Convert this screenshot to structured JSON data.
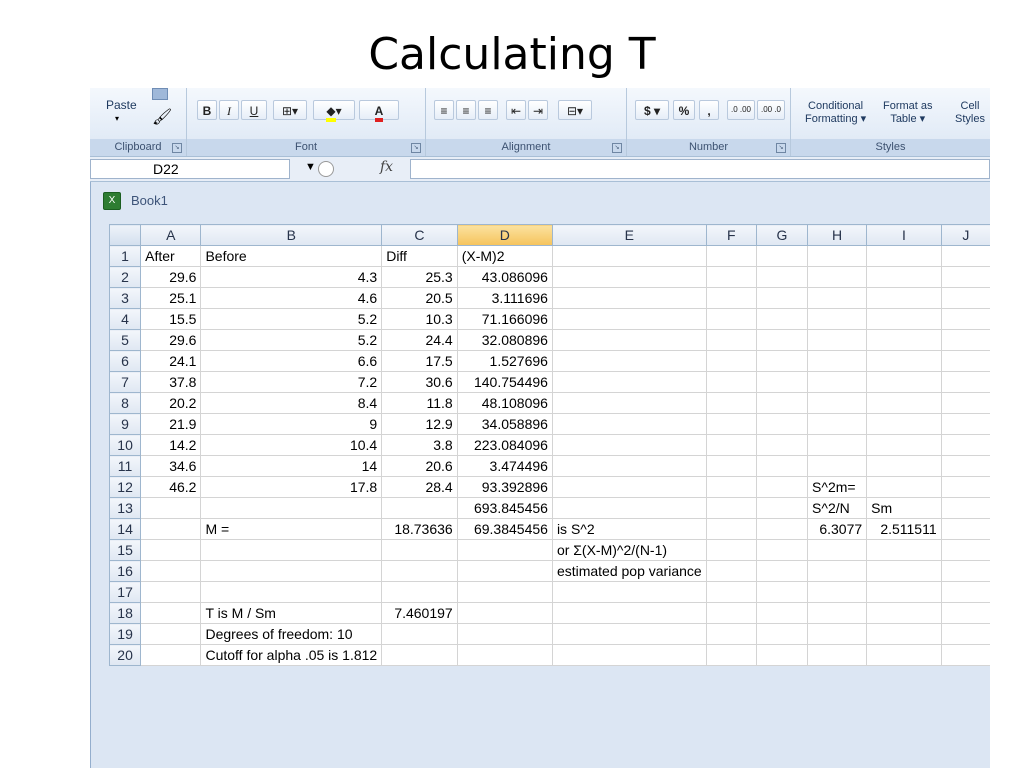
{
  "slide": {
    "title": "Calculating T"
  },
  "ribbon": {
    "paste_label": "Paste",
    "groups": {
      "clipboard": "Clipboard",
      "font": "Font",
      "alignment": "Alignment",
      "number": "Number",
      "styles": "Styles"
    },
    "font_buttons": {
      "bold": "B",
      "italic": "I",
      "underline": "U",
      "font_color": "A"
    },
    "number_buttons": {
      "currency": "$",
      "percent": "%",
      "comma": ",",
      "inc_decimal": ".0 .00",
      "dec_decimal": ".00 .0"
    },
    "styles_buttons": {
      "conditional_line1": "Conditional",
      "conditional_line2": "Formatting",
      "format_table_line1": "Format as",
      "format_table_line2": "Table",
      "cell_styles_line1": "Cell",
      "cell_styles_line2": "Styles"
    }
  },
  "formula_bar": {
    "cell_ref": "D22",
    "fx_label": "fx",
    "value": ""
  },
  "workbook": {
    "title": "Book1"
  },
  "sheet": {
    "columns": [
      "A",
      "B",
      "C",
      "D",
      "E",
      "F",
      "G",
      "H",
      "I",
      "J"
    ],
    "active_column": "D",
    "rows": [
      {
        "n": "1",
        "cells": [
          "After",
          "Before",
          "Diff",
          "(X-M)2",
          "",
          "",
          "",
          "",
          "",
          ""
        ]
      },
      {
        "n": "2",
        "cells": [
          "29.6",
          "4.3",
          "25.3",
          "43.086096",
          "",
          "",
          "",
          "",
          "",
          ""
        ]
      },
      {
        "n": "3",
        "cells": [
          "25.1",
          "4.6",
          "20.5",
          "3.111696",
          "",
          "",
          "",
          "",
          "",
          ""
        ]
      },
      {
        "n": "4",
        "cells": [
          "15.5",
          "5.2",
          "10.3",
          "71.166096",
          "",
          "",
          "",
          "",
          "",
          ""
        ]
      },
      {
        "n": "5",
        "cells": [
          "29.6",
          "5.2",
          "24.4",
          "32.080896",
          "",
          "",
          "",
          "",
          "",
          ""
        ]
      },
      {
        "n": "6",
        "cells": [
          "24.1",
          "6.6",
          "17.5",
          "1.527696",
          "",
          "",
          "",
          "",
          "",
          ""
        ]
      },
      {
        "n": "7",
        "cells": [
          "37.8",
          "7.2",
          "30.6",
          "140.754496",
          "",
          "",
          "",
          "",
          "",
          ""
        ]
      },
      {
        "n": "8",
        "cells": [
          "20.2",
          "8.4",
          "11.8",
          "48.108096",
          "",
          "",
          "",
          "",
          "",
          ""
        ]
      },
      {
        "n": "9",
        "cells": [
          "21.9",
          "9",
          "12.9",
          "34.058896",
          "",
          "",
          "",
          "",
          "",
          ""
        ]
      },
      {
        "n": "10",
        "cells": [
          "14.2",
          "10.4",
          "3.8",
          "223.084096",
          "",
          "",
          "",
          "",
          "",
          ""
        ]
      },
      {
        "n": "11",
        "cells": [
          "34.6",
          "14",
          "20.6",
          "3.474496",
          "",
          "",
          "",
          "",
          "",
          ""
        ]
      },
      {
        "n": "12",
        "cells": [
          "46.2",
          "17.8",
          "28.4",
          "93.392896",
          "",
          "",
          "",
          "S^2m=",
          "",
          ""
        ]
      },
      {
        "n": "13",
        "cells": [
          "",
          "",
          "",
          "693.845456",
          "",
          "",
          "",
          "S^2/N",
          "Sm",
          ""
        ]
      },
      {
        "n": "14",
        "cells": [
          "",
          "M =",
          "18.73636",
          "69.3845456",
          "is S^2",
          "",
          "",
          "6.3077",
          "2.511511",
          ""
        ]
      },
      {
        "n": "15",
        "cells": [
          "",
          "",
          "",
          "",
          "or Σ(X-M)^2/(N-1)",
          "",
          "",
          "",
          "",
          ""
        ]
      },
      {
        "n": "16",
        "cells": [
          "",
          "",
          "",
          "",
          "estimated pop variance",
          "",
          "",
          "",
          "",
          ""
        ]
      },
      {
        "n": "17",
        "cells": [
          "",
          "",
          "",
          "",
          "",
          "",
          "",
          "",
          "",
          ""
        ]
      },
      {
        "n": "18",
        "cells": [
          "",
          "T is M / Sm",
          "7.460197",
          "",
          "",
          "",
          "",
          "",
          "",
          ""
        ]
      },
      {
        "n": "19",
        "cells": [
          "",
          "Degrees of freedom: 10",
          "",
          "",
          "",
          "",
          "",
          "",
          "",
          ""
        ]
      },
      {
        "n": "20",
        "cells": [
          "",
          "Cutoff for alpha .05 is 1.812",
          "",
          "",
          "",
          "",
          "",
          "",
          "",
          ""
        ]
      }
    ]
  },
  "colors": {
    "accent": "#f5c35c",
    "ribbon": "#dbe6f4",
    "workbook_frame": "#dce6f3"
  }
}
